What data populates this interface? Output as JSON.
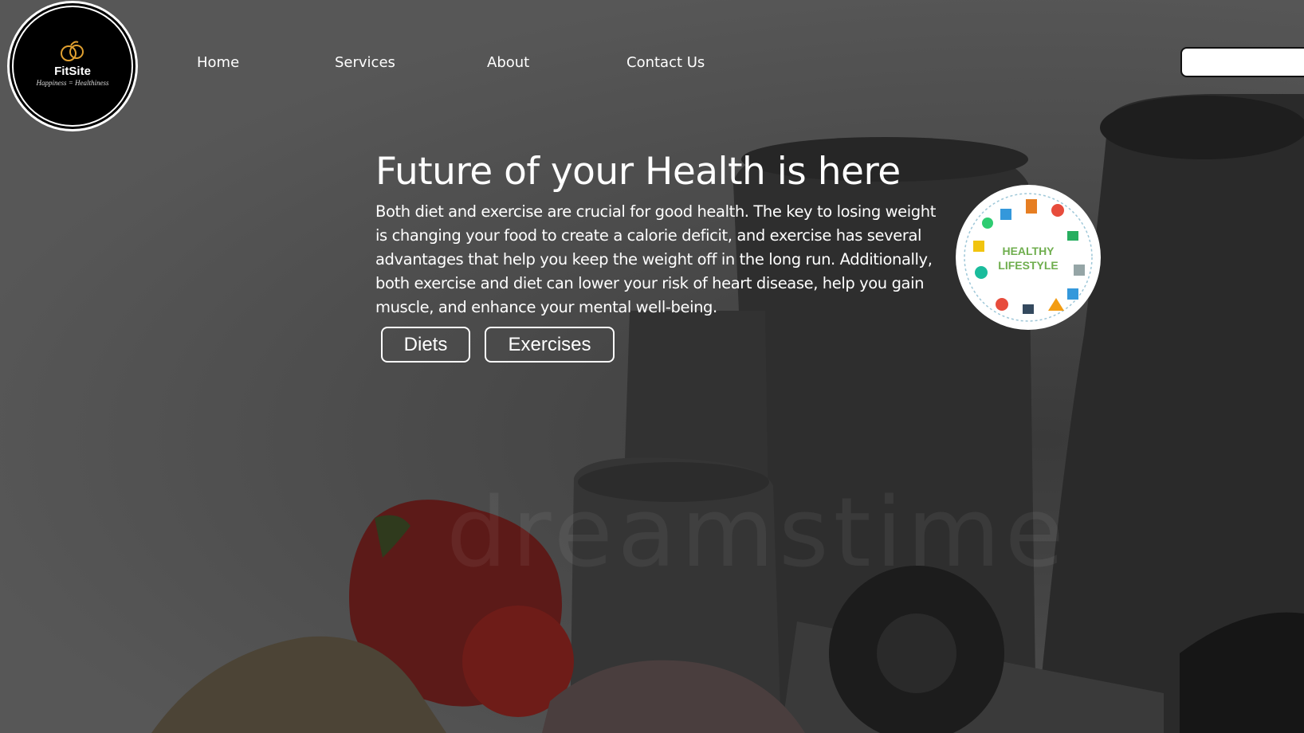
{
  "brand": {
    "name": "FitSite",
    "tagline": "Happiness = Healthiness"
  },
  "nav": {
    "items": [
      "Home",
      "Services",
      "About",
      "Contact Us"
    ]
  },
  "search": {
    "placeholder": ""
  },
  "hero": {
    "title": "Future of your Health is here",
    "body": "Both diet and exercise are crucial for good health. The key to losing weight is changing your food to create a calorie deficit, and exercise has several advantages that help you keep the weight off in the long run. Additionally, both exercise and diet can lower your risk of heart disease, help you gain muscle, and enhance your mental well-being.",
    "buttons": {
      "diets": "Diets",
      "exercises": "Exercises"
    }
  },
  "badge": {
    "line1": "HEALTHY",
    "line2": "LIFESTYLE"
  },
  "watermark": "dreamstime",
  "icons": {
    "logo": "fruit-logo-icon",
    "badge": "healthy-lifestyle-icon"
  },
  "colors": {
    "overlay": "#565656",
    "text": "#ffffff",
    "badge_green": "#6fae4e",
    "pepper": "#7a1a18"
  }
}
